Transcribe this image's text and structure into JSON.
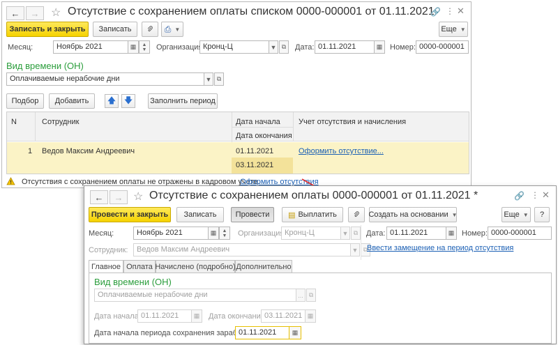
{
  "colors": {
    "primary_button": "#f5d200",
    "group_heading": "#2a9d3b",
    "link": "#1a5fb4",
    "selected_row": "#fbf3c6",
    "annotation_arrow": "#e23030"
  },
  "list_doc": {
    "title": "Отсутствие с сохранением оплаты списком 0000-000001 от 01.11.2021",
    "toolbar": {
      "save_close": "Записать и закрыть",
      "save": "Записать",
      "more": "Еще"
    },
    "month_label": "Месяц:",
    "month_value": "Ноябрь 2021",
    "org_label": "Организация:",
    "org_value": "Кронц-Ц",
    "date_label": "Дата:",
    "date_value": "01.11.2021",
    "number_label": "Номер:",
    "number_value": "0000-000001",
    "time_type_heading": "Вид времени (ОН)",
    "time_type_value": "Оплачиваемые нерабочие дни",
    "table_toolbar": {
      "pick": "Подбор",
      "add": "Добавить",
      "fill_period": "Заполнить период"
    },
    "columns": {
      "n": "N",
      "employee": "Сотрудник",
      "start_date": "Дата начала",
      "end_date": "Дата окончания",
      "accounting": "Учет отсутствия и начисления"
    },
    "rows": [
      {
        "n": "1",
        "employee": "Ведов Максим Андреевич",
        "start_date": "01.11.2021",
        "end_date": "03.11.2021",
        "action": "Оформить отсутствие..."
      }
    ],
    "warning_text": "Отсутствия с сохранением оплаты не отражены в кадровом учете.",
    "warning_link": "Оформить отсутствия"
  },
  "single_doc": {
    "title": "Отсутствие с сохранением оплаты 0000-000001 от 01.11.2021 *",
    "toolbar": {
      "post_close": "Провести и закрыть",
      "save": "Записать",
      "post": "Провести",
      "pay": "Выплатить",
      "create_based": "Создать на основании",
      "more": "Еще",
      "help": "?"
    },
    "month_label": "Месяц:",
    "month_value": "Ноябрь 2021",
    "org_label": "Организация:",
    "org_value": "Кронц-Ц",
    "date_label": "Дата:",
    "date_value": "01.11.2021",
    "number_label": "Номер:",
    "number_value": "0000-000001",
    "employee_label": "Сотрудник:",
    "employee_value": "Ведов Максим Андреевич",
    "replacement_link": "Ввести замещение на период отсутствия",
    "tabs": [
      "Главное",
      "Оплата",
      "Начислено (подробно)",
      "Дополнительно"
    ],
    "time_type_heading": "Вид времени (ОН)",
    "time_type_value": "Оплачиваемые нерабочие дни",
    "start_label": "Дата начала:",
    "start_value": "01.11.2021",
    "end_label": "Дата окончания:",
    "end_value": "03.11.2021",
    "pay_start_label": "Дата начала периода сохранения заработка:",
    "pay_start_value": "01.11.2021"
  }
}
